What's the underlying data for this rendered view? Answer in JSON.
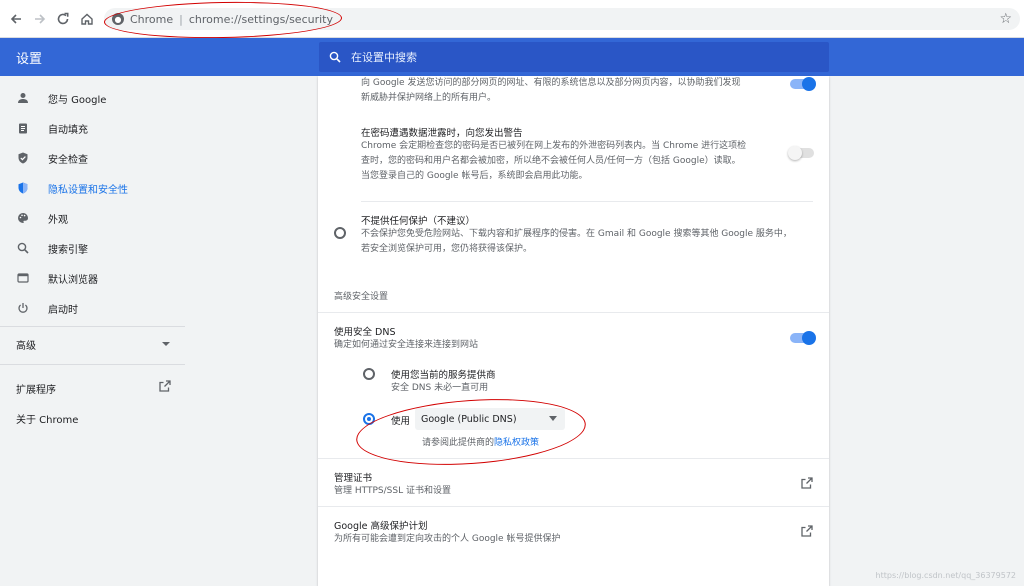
{
  "browser": {
    "site_name": "Chrome",
    "separator": "|",
    "url": "chrome://settings/security"
  },
  "header": {
    "title": "设置",
    "search_placeholder": "在设置中搜索"
  },
  "sidebar": {
    "items": [
      {
        "label": "您与 Google",
        "icon": "person-icon"
      },
      {
        "label": "自动填充",
        "icon": "clipboard-icon"
      },
      {
        "label": "安全检查",
        "icon": "shield-check-icon"
      },
      {
        "label": "隐私设置和安全性",
        "icon": "shield-icon",
        "active": true
      },
      {
        "label": "外观",
        "icon": "palette-icon"
      },
      {
        "label": "搜索引擎",
        "icon": "search-icon"
      },
      {
        "label": "默认浏览器",
        "icon": "browser-icon"
      },
      {
        "label": "启动时",
        "icon": "power-icon"
      }
    ],
    "advanced": "高级",
    "extensions": "扩展程序",
    "about": "关于 Chrome"
  },
  "main": {
    "top_desc_1": "向 Google 发送您访问的部分网页的网址、有限的系统信息以及部分网页内容，以协助我们发现",
    "top_desc_2": "新威胁并保护网络上的所有用户。",
    "pw_title": "在密码遭遇数据泄露时，向您发出警告",
    "pw_desc_1": "Chrome 会定期检查您的密码是否已被列在网上发布的外泄密码列表内。当 Chrome 进行这项检",
    "pw_desc_2": "查时，您的密码和用户名都会被加密，所以绝不会被任何人员/任何一方（包括 Google）读取。",
    "pw_desc_3": "当您登录自己的 Google 帐号后，系统即会启用此功能。",
    "noprot_title": "不提供任何保护（不建议）",
    "noprot_desc_1": "不会保护您免受危险网站、下载内容和扩展程序的侵害。在 Gmail 和 Google 搜索等其他 Google 服务中，",
    "noprot_desc_2": "若安全浏览保护可用，您仍将获得该保护。",
    "advanced_header": "高级安全设置",
    "dns_title": "使用安全 DNS",
    "dns_desc": "确定如何通过安全连接来连接到网站",
    "dns_opt1_title": "使用您当前的服务提供商",
    "dns_opt1_desc": "安全 DNS 未必一直可用",
    "dns_opt2_label": "使用",
    "dns_provider": "Google (Public DNS)",
    "dns_policy_prefix": "请参阅此提供商的",
    "dns_policy_link": "隐私权政策",
    "cert_title": "管理证书",
    "cert_desc": "管理 HTTPS/SSL 证书和设置",
    "adv_prot_title": "Google 高级保护计划",
    "adv_prot_desc": "为所有可能会遭到定向攻击的个人 Google 帐号提供保护"
  },
  "watermark": "https://blog.csdn.net/qq_36379572"
}
